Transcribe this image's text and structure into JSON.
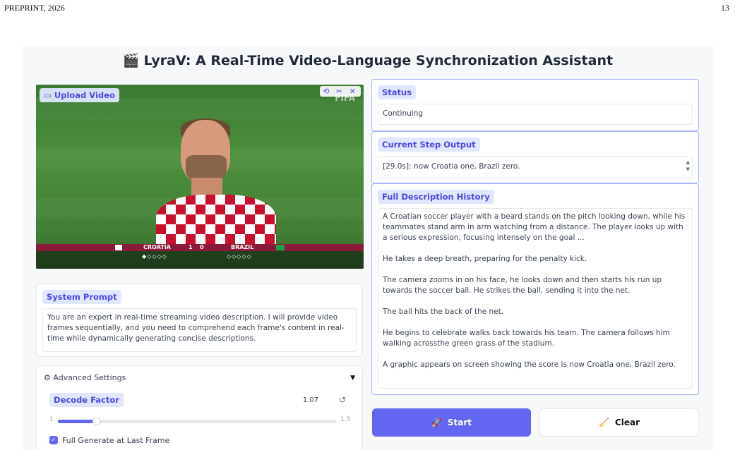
{
  "paper": {
    "left": "PREPRINT, 2026",
    "right": "13"
  },
  "app": {
    "title": "LyraV: A Real-Time Video-Language Synchronization Assistant",
    "title_icon": "clapperboard-icon"
  },
  "video": {
    "upload_label": "Upload Video",
    "tools": "⟲ ✂ ✕",
    "watermark": "FIFA",
    "score": {
      "team1": "CROATIA",
      "score1": "1",
      "score2": "0",
      "team2": "BRAZIL",
      "dots1": "◆◇◇◇◇",
      "dots2": "◇◇◇◇◇"
    }
  },
  "system_prompt": {
    "label": "System Prompt",
    "text": "You are an expert in real-time streaming video description. I will provide video frames sequentially, and you need to comprehend each frame's content in real-time while dynamically generating concise descriptions."
  },
  "advanced": {
    "header": "Advanced Settings",
    "decode_factor": {
      "label": "Decode Factor",
      "value": "1.07",
      "min": "1",
      "max": "1.5",
      "fraction": 0.14
    },
    "full_generate": {
      "label": "Full Generate at Last Frame",
      "checked": true
    }
  },
  "status": {
    "label": "Status",
    "value": "Continuing"
  },
  "current_step": {
    "label": "Current Step Output",
    "value": "[29.0s]: now Croatia one, Brazil zero."
  },
  "history": {
    "label": "Full Description History",
    "paragraphs": [
      "A Croatian soccer player with a beard stands on the pitch looking down, while his teammates stand arm in arm watching from a distance. The player looks up with a serious expression, focusing intensely on the goal ...",
      "He takes a deep breath, preparing for the penalty kick.",
      "The camera zooms in on his face, he looks down and then starts his run up towards the soccer ball. He strikes the ball, sending it into the net.",
      "The ball hits the back of the net.",
      "He begins to celebrate walks back towards his team. The camera follows him walking acrossthe green grass of the stadium.",
      "A graphic appears on screen showing the score is now Croatia one, Brazil zero."
    ]
  },
  "buttons": {
    "start": "Start",
    "clear": "Clear"
  }
}
